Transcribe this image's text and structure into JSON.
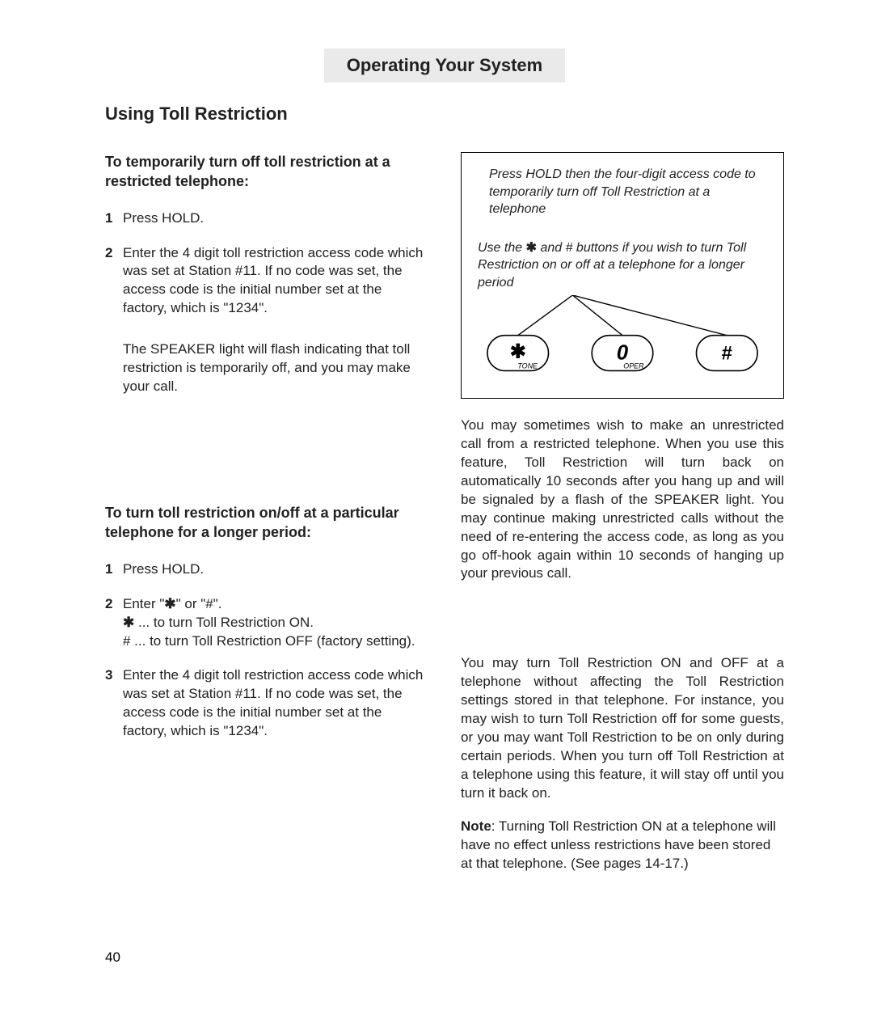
{
  "header": {
    "title": "Operating Your System"
  },
  "section_title": "Using Toll Restriction",
  "left": {
    "block1": {
      "heading": "To temporarily turn off toll restriction at a restricted telephone:",
      "step1_num": "1",
      "step1": "Press HOLD.",
      "step2_num": "2",
      "step2": "Enter the 4 digit toll restriction access code which was set at Station #11.  If no code was set, the access code is the initial number set at the factory, which is \"1234\".",
      "note": "The SPEAKER light will flash indicating that toll restriction is temporarily off, and you may make your call."
    },
    "block2": {
      "heading": "To turn toll restriction on/off at a particular telephone for a longer period:",
      "step1_num": "1",
      "step1": "Press HOLD.",
      "step2_num": "2",
      "step2_pre": "Enter \"",
      "step2_mid": "\" or \"#\".",
      "step2_line2a": " ... to turn Toll Restriction ON.",
      "step2_line3": "# ... to turn Toll Restriction OFF (factory setting).",
      "step3_num": "3",
      "step3": "Enter the 4 digit toll restriction access code which was set at Station #11.  If no code was set, the access code is the initial number set at the factory, which is \"1234\"."
    }
  },
  "right": {
    "diagram": {
      "line1": "Press HOLD then the four-digit access code to temporarily turn off Toll Restriction at a telephone",
      "line2a": "Use the ",
      "line2b": " and # buttons if you wish to turn Toll Restriction on or off at a telephone for a longer period",
      "key_star": "✱",
      "key_star_sub": "TONE",
      "key_zero": "0",
      "key_zero_sub": "OPER",
      "key_hash": "#"
    },
    "para1": "You may sometimes wish to make an unrestricted call from a restricted telephone.  When you use this feature, Toll Restriction will turn back on automatically 10 seconds after you hang up and will be signaled by a flash of the SPEAKER light.  You may continue making unrestricted calls without the need of re-entering the access code, as long as you go off-hook again within 10 seconds of hanging up your previous call.",
    "para2": "You may turn Toll Restriction ON and OFF at a telephone without affecting the Toll Restriction settings stored in that telephone.  For instance, you may wish to turn Toll Restriction off for some guests, or you may want Toll Restriction to be on only during certain periods.  When you turn off Toll Restriction at a telephone using this feature, it will stay off until you turn it back on.",
    "note_label": "Note",
    "note_body": ": Turning Toll Restriction ON at a telephone will have no effect unless restrictions have been stored at that telephone. (See pages 14-17.)"
  },
  "page_number": "40",
  "glyphs": {
    "star": "✱"
  }
}
